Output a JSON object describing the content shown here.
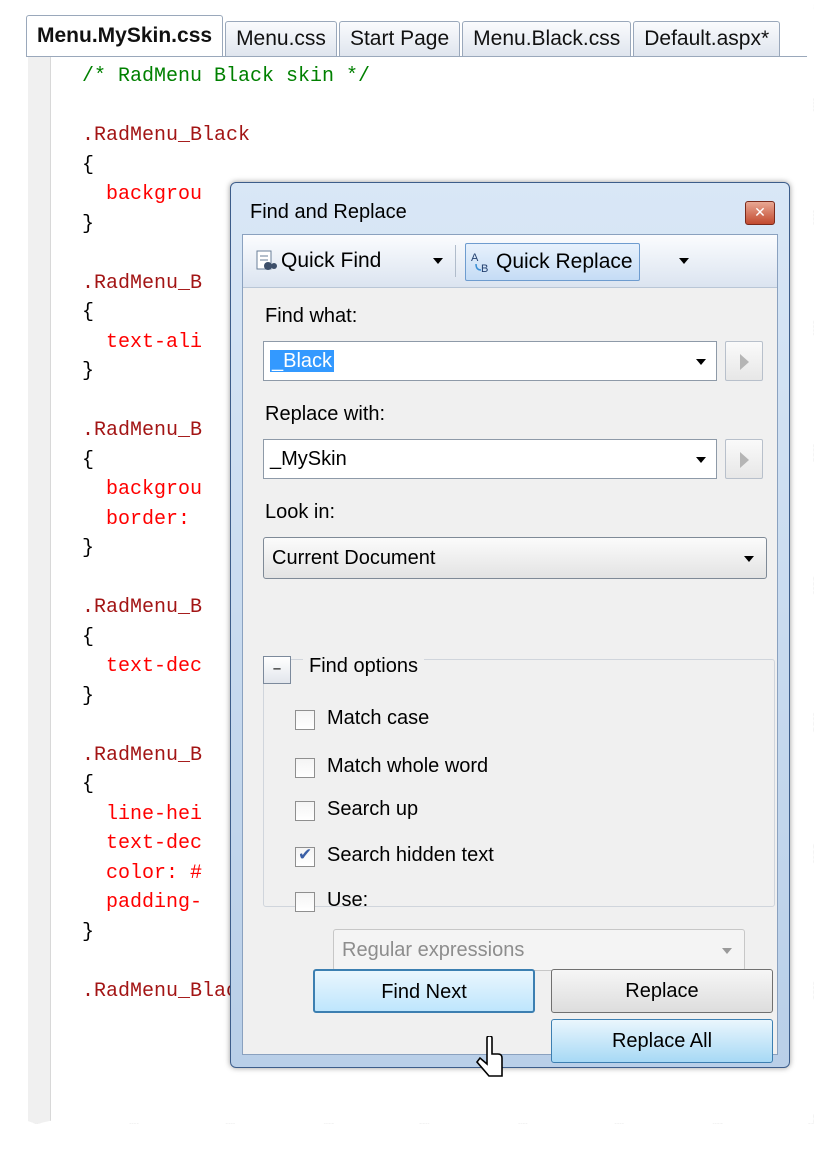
{
  "tabs": [
    "Menu.MySkin.css",
    "Menu.css",
    "Start Page",
    "Menu.Black.css",
    "Default.aspx*"
  ],
  "code": [
    {
      "t": "/* RadMenu Black skin */",
      "k": "comment"
    },
    {
      "t": "",
      "k": "blank"
    },
    {
      "t": ".RadMenu_Black",
      "k": "sel"
    },
    {
      "t": "{",
      "k": "brace"
    },
    {
      "t": "  backgrou",
      "k": "prop"
    },
    {
      "t": "}",
      "k": "brace"
    },
    {
      "t": "",
      "k": "blank"
    },
    {
      "t": ".RadMenu_B",
      "k": "sel"
    },
    {
      "t": "{",
      "k": "brace"
    },
    {
      "t": "  text-ali",
      "k": "prop"
    },
    {
      "t": "}",
      "k": "brace"
    },
    {
      "t": "",
      "k": "blank"
    },
    {
      "t": ".RadMenu_B",
      "k": "sel"
    },
    {
      "t": "{",
      "k": "brace"
    },
    {
      "t": "  backgrou",
      "k": "prop"
    },
    {
      "t": "  border:",
      "k": "prop"
    },
    {
      "t": "}",
      "k": "brace"
    },
    {
      "t": "",
      "k": "blank"
    },
    {
      "t": ".RadMenu_B",
      "k": "sel"
    },
    {
      "t": "{",
      "k": "brace"
    },
    {
      "t": "  text-dec",
      "k": "prop"
    },
    {
      "t": "}",
      "k": "brace"
    },
    {
      "t": "",
      "k": "blank"
    },
    {
      "t": ".RadMenu_B",
      "k": "sel"
    },
    {
      "t": "{",
      "k": "brace"
    },
    {
      "t": "  line-hei",
      "k": "prop"
    },
    {
      "t": "  text-dec",
      "k": "prop"
    },
    {
      "t": "  color: #",
      "k": "prop"
    },
    {
      "t": "  padding-",
      "k": "prop"
    },
    {
      "t": "}",
      "k": "brace"
    },
    {
      "t": "",
      "k": "blank"
    },
    {
      "t": ".RadMenu_Black .rmLink:focused",
      "k": "sel"
    }
  ],
  "dialog": {
    "title": "Find and Replace",
    "quick_find": "Quick Find",
    "quick_replace": "Quick Replace",
    "find_what_label": "Find what:",
    "find_what_value": "_Black",
    "replace_with_label": "Replace with:",
    "replace_with_value": "_MySkin",
    "look_in_label": "Look in:",
    "look_in_value": "Current Document",
    "find_options_label": "Find options",
    "options": [
      {
        "label": "Match case",
        "checked": false
      },
      {
        "label": "Match whole word",
        "checked": false
      },
      {
        "label": "Search up",
        "checked": false
      },
      {
        "label": "Search hidden text",
        "checked": true
      },
      {
        "label": "Use:",
        "checked": false
      }
    ],
    "use_value": "Regular expressions",
    "find_next": "Find Next",
    "replace": "Replace",
    "replace_all": "Replace All"
  }
}
